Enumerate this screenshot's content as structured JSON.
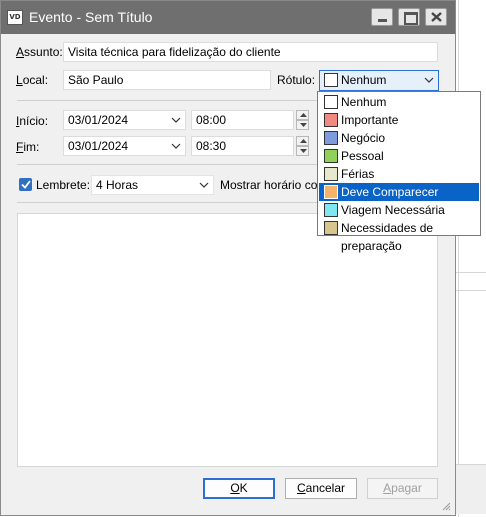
{
  "window": {
    "title": "Evento - Sem Título",
    "app_icon_text": "VD"
  },
  "form": {
    "subject_label_u": "A",
    "subject_label_rest": "ssunto:",
    "subject_value": "Visita técnica para fidelização do cliente",
    "location_label_u": "L",
    "location_label_rest": "ocal:",
    "location_value": "São Paulo",
    "label_label": "Rótulo:",
    "label_selected": "Nenhum",
    "start_label_u": "I",
    "start_label_rest": "nício:",
    "start_date": "03/01/2024",
    "start_time": "08:00",
    "end_label_u": "F",
    "end_label_rest": "im:",
    "end_date": "03/01/2024",
    "end_time": "08:30",
    "reminder_label": "Lembrete:",
    "reminder_checked": true,
    "reminder_value": "4 Horas",
    "show_time_label": "Mostrar horário como"
  },
  "label_dropdown": {
    "items": [
      {
        "label": "Nenhum",
        "color": "#ffffff"
      },
      {
        "label": "Importante",
        "color": "#f08a80"
      },
      {
        "label": "Negócio",
        "color": "#7f9be0"
      },
      {
        "label": "Pessoal",
        "color": "#8ed25a"
      },
      {
        "label": "Férias",
        "color": "#e8e8cc"
      },
      {
        "label": "Deve Comparecer",
        "color": "#f5b36b"
      },
      {
        "label": "Viagem Necessária",
        "color": "#7fe6f2"
      },
      {
        "label": "Necessidades de preparação",
        "color": "#d6c68e"
      }
    ],
    "highlighted_index": 5
  },
  "buttons": {
    "ok_u": "O",
    "ok_rest": "K",
    "cancel_u": "C",
    "cancel_rest": "ancelar",
    "delete_u": "A",
    "delete_rest": "pagar",
    "delete_enabled": false
  }
}
